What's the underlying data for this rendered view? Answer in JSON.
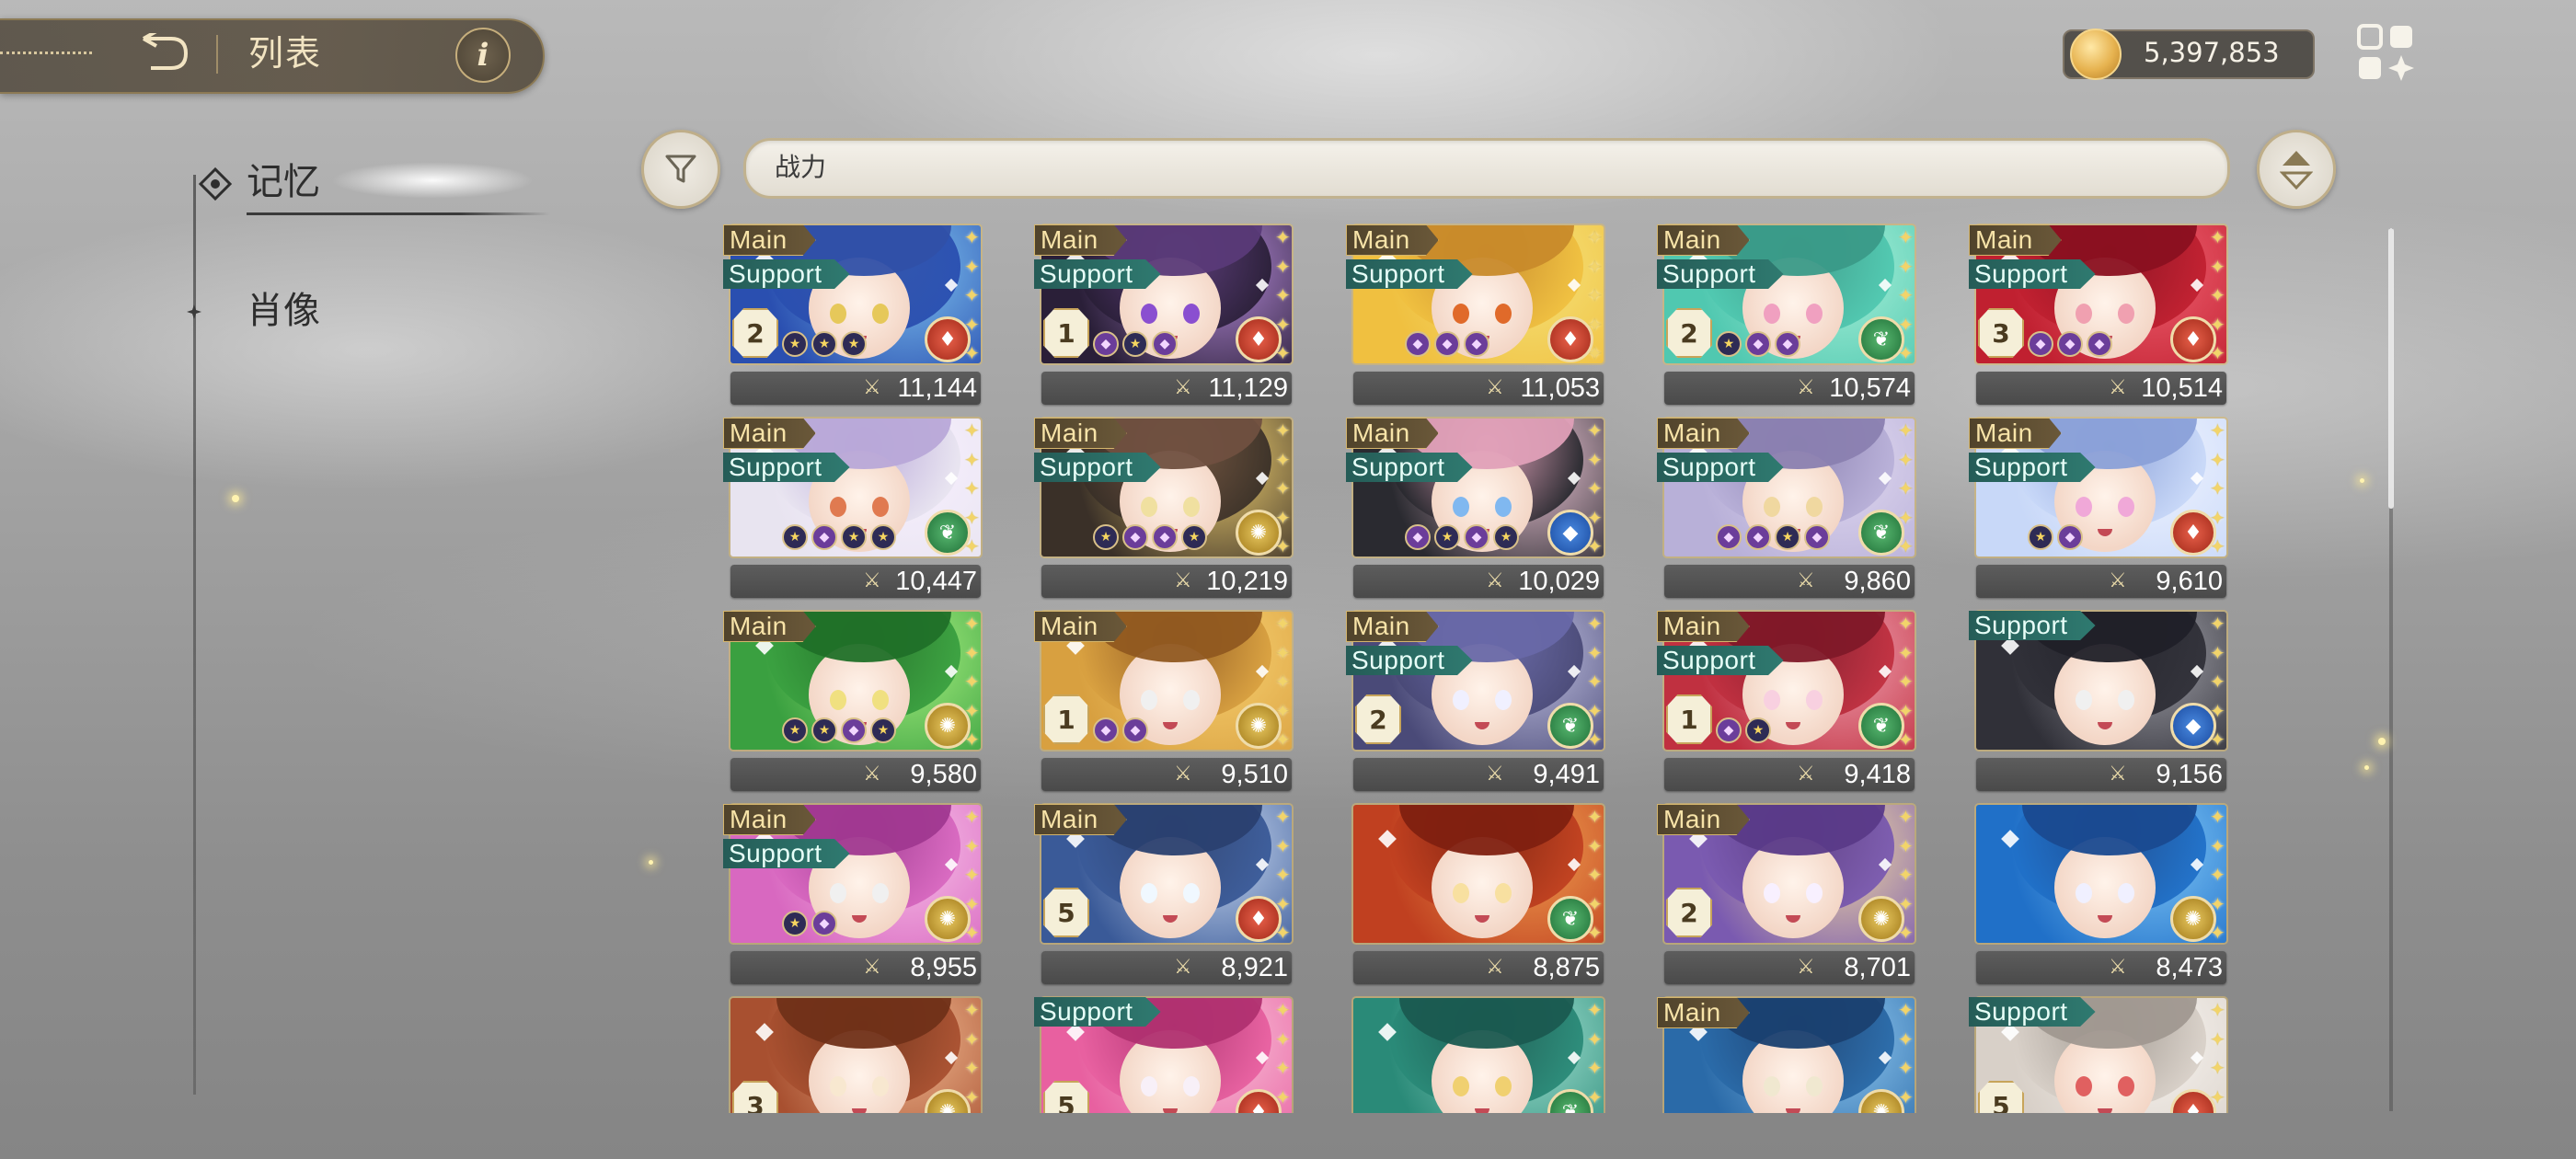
{
  "header": {
    "title": "列表",
    "info_label": "i"
  },
  "currency": {
    "value": "5,397,853"
  },
  "sidebar": {
    "items": [
      {
        "label": "记忆",
        "selected": true
      },
      {
        "label": "肖像",
        "selected": false
      }
    ]
  },
  "search": {
    "value": "战力"
  },
  "colors": {
    "gold": "#d4b56c",
    "main_tag": "#50432b",
    "support_tag": "#2f7a70",
    "star": "#f2d46a"
  },
  "cards": [
    {
      "tags": [
        "Main",
        "Support"
      ],
      "level": "2",
      "gems": [
        "star",
        "star",
        "star"
      ],
      "attr": "fire",
      "power": "11,144",
      "theme": [
        "#2a4fb0",
        "#7fc4f0",
        "#3050a8",
        "#e6c85a"
      ]
    },
    {
      "tags": [
        "Main",
        "Support"
      ],
      "level": "1",
      "gems": [
        "purple",
        "star",
        "purple"
      ],
      "attr": "fire",
      "power": "11,129",
      "theme": [
        "#2a1f38",
        "#b58ad8",
        "#5a3a78",
        "#8a4fd0"
      ]
    },
    {
      "tags": [
        "Main",
        "Support"
      ],
      "level": "",
      "gems": [
        "purple",
        "purple",
        "purple"
      ],
      "attr": "fire",
      "power": "11,053",
      "theme": [
        "#f0c040",
        "#f5e27a",
        "#c88a2a",
        "#e06a2a"
      ]
    },
    {
      "tags": [
        "Main",
        "Support"
      ],
      "level": "2",
      "gems": [
        "star",
        "purple",
        "purple"
      ],
      "attr": "wood",
      "power": "10,574",
      "theme": [
        "#50c8b0",
        "#a8f0d8",
        "#3a9a88",
        "#f0a0c0"
      ]
    },
    {
      "tags": [
        "Main",
        "Support"
      ],
      "level": "3",
      "gems": [
        "purple",
        "purple",
        "purple"
      ],
      "attr": "fire",
      "power": "10,514",
      "theme": [
        "#c02030",
        "#f06070",
        "#8a1020",
        "#f0a0b0"
      ]
    },
    {
      "tags": [
        "Main",
        "Support"
      ],
      "level": "",
      "gems": [
        "star",
        "purple",
        "star",
        "star"
      ],
      "attr": "wood",
      "power": "10,447",
      "theme": [
        "#e8e4f0",
        "#f8f0ff",
        "#b8a8d8",
        "#e07a50"
      ]
    },
    {
      "tags": [
        "Main",
        "Support"
      ],
      "level": "",
      "gems": [
        "star",
        "purple",
        "purple",
        "star"
      ],
      "attr": "light",
      "power": "10,219",
      "theme": [
        "#3a3028",
        "#f0d070",
        "#705040",
        "#f0e0a0"
      ]
    },
    {
      "tags": [
        "Main",
        "Support"
      ],
      "level": "",
      "gems": [
        "purple",
        "star",
        "purple",
        "star"
      ],
      "attr": "water",
      "power": "10,029",
      "theme": [
        "#2a2a30",
        "#f0c8d8",
        "#e0a0b8",
        "#80b8f0"
      ]
    },
    {
      "tags": [
        "Main",
        "Support"
      ],
      "level": "",
      "gems": [
        "purple",
        "purple",
        "star",
        "purple"
      ],
      "attr": "wood",
      "power": "9,860",
      "theme": [
        "#b8b0d8",
        "#e0d8f0",
        "#8a80b0",
        "#f0d8a0"
      ]
    },
    {
      "tags": [
        "Main",
        "Support"
      ],
      "level": "",
      "gems": [
        "star",
        "purple"
      ],
      "attr": "fire",
      "power": "9,610",
      "theme": [
        "#c8d8f8",
        "#f0f4ff",
        "#8aa0d8",
        "#f0a8d8"
      ]
    },
    {
      "tags": [
        "Main"
      ],
      "level": "",
      "gems": [
        "star",
        "star",
        "purple",
        "star"
      ],
      "attr": "light",
      "power": "9,580",
      "theme": [
        "#3aa040",
        "#a8f080",
        "#207028",
        "#f0e080"
      ]
    },
    {
      "tags": [
        "Main"
      ],
      "level": "1",
      "gems": [
        "purple",
        "purple"
      ],
      "attr": "light",
      "power": "9,510",
      "theme": [
        "#d8a040",
        "#f8d070",
        "#905820",
        "#f0f0f0"
      ]
    },
    {
      "tags": [
        "Main",
        "Support"
      ],
      "level": "2",
      "gems": [],
      "attr": "wood",
      "power": "9,491",
      "theme": [
        "#4a4a78",
        "#c0c0e0",
        "#6868a8",
        "#f0f0ff"
      ]
    },
    {
      "tags": [
        "Main",
        "Support"
      ],
      "level": "1",
      "gems": [
        "purple",
        "star"
      ],
      "attr": "wood",
      "power": "9,418",
      "theme": [
        "#c03040",
        "#f0a0b0",
        "#801828",
        "#f8d0e0"
      ]
    },
    {
      "tags": [
        "Support"
      ],
      "level": "",
      "gems": [],
      "attr": "water",
      "power": "9,156",
      "theme": [
        "#303038",
        "#a0a0a8",
        "#202028",
        "#f0f0f0"
      ]
    },
    {
      "tags": [
        "Main",
        "Support"
      ],
      "level": "",
      "gems": [
        "star",
        "purple"
      ],
      "attr": "light",
      "power": "8,955",
      "theme": [
        "#d868c0",
        "#f8c0e8",
        "#a03890",
        "#f0f0f0"
      ]
    },
    {
      "tags": [
        "Main"
      ],
      "level": "5",
      "gems": [],
      "attr": "fire",
      "power": "8,921",
      "theme": [
        "#3a5a98",
        "#c8d8f0",
        "#2a4070",
        "#f0f8ff"
      ]
    },
    {
      "tags": [],
      "level": "",
      "gems": [],
      "attr": "wood",
      "power": "8,875",
      "theme": [
        "#c04020",
        "#f0a050",
        "#802010",
        "#f8e0a0"
      ]
    },
    {
      "tags": [
        "Main"
      ],
      "level": "2",
      "gems": [],
      "attr": "light",
      "power": "8,701",
      "theme": [
        "#7a5ab0",
        "#f0d8a0",
        "#5a3a88",
        "#f8f0ff"
      ]
    },
    {
      "tags": [],
      "level": "",
      "gems": [],
      "attr": "light",
      "power": "8,473",
      "theme": [
        "#2070c8",
        "#80c8f8",
        "#1a4a90",
        "#f0f0ff"
      ]
    },
    {
      "tags": [],
      "level": "3",
      "gems": [],
      "attr": "light",
      "power": "",
      "theme": [
        "#a85030",
        "#f0b890",
        "#703018",
        "#f8e8d0"
      ]
    },
    {
      "tags": [
        "Support"
      ],
      "level": "5",
      "gems": [],
      "attr": "fire",
      "power": "",
      "theme": [
        "#e860a0",
        "#f8c0d8",
        "#b03070",
        "#f8f0f8"
      ]
    },
    {
      "tags": [],
      "level": "",
      "gems": [],
      "attr": "wood",
      "power": "",
      "theme": [
        "#2a8a78",
        "#a0e0d0",
        "#1a5a50",
        "#f0d070"
      ]
    },
    {
      "tags": [
        "Main"
      ],
      "level": "",
      "gems": [],
      "attr": "light",
      "power": "",
      "theme": [
        "#2a6aa8",
        "#90c8f0",
        "#1a4070",
        "#f0e8d0"
      ]
    },
    {
      "tags": [
        "Support"
      ],
      "level": "5",
      "gems": [],
      "attr": "fire",
      "power": "",
      "theme": [
        "#d8d0c8",
        "#f8f4f0",
        "#a09890",
        "#e06060"
      ]
    }
  ]
}
